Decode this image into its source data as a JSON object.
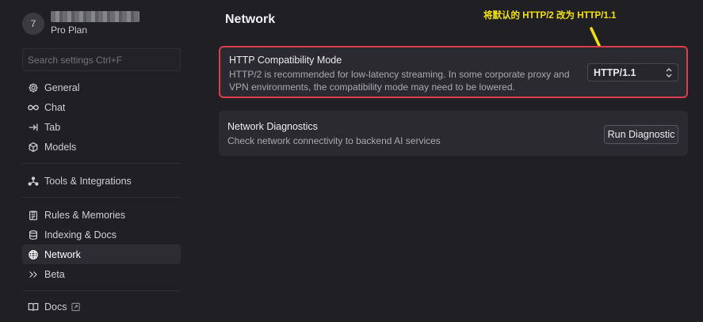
{
  "profile": {
    "avatar_initial": "7",
    "plan": "Pro Plan"
  },
  "sidebar": {
    "search_placeholder": "Search settings Ctrl+F",
    "items": [
      {
        "label": "General",
        "icon": "gear-icon"
      },
      {
        "label": "Chat",
        "icon": "infinity-icon"
      },
      {
        "label": "Tab",
        "icon": "tab-arrow-icon"
      },
      {
        "label": "Models",
        "icon": "cube-icon"
      },
      {
        "label": "Tools & Integrations",
        "icon": "nodes-icon"
      },
      {
        "label": "Rules & Memories",
        "icon": "clipboard-icon"
      },
      {
        "label": "Indexing & Docs",
        "icon": "database-icon"
      },
      {
        "label": "Network",
        "icon": "globe-icon",
        "active": true
      },
      {
        "label": "Beta",
        "icon": "double-chevron-icon"
      },
      {
        "label": "Docs",
        "icon": "book-icon"
      }
    ]
  },
  "main": {
    "title": "Network",
    "annotation": "将默认的 HTTP/2 改为 HTTP/1.1",
    "annotation_color": "#f5e400",
    "highlight_color": "#e03c50",
    "compat": {
      "title": "HTTP Compatibility Mode",
      "desc_line1": "HTTP/2 is recommended for low-latency streaming. In some corporate proxy and",
      "desc_line2": "VPN environments, the compatibility mode may need to be lowered.",
      "selected": "HTTP/1.1"
    },
    "diag": {
      "title": "Network Diagnostics",
      "desc": "Check network connectivity to backend AI services",
      "button": "Run Diagnostic"
    }
  }
}
